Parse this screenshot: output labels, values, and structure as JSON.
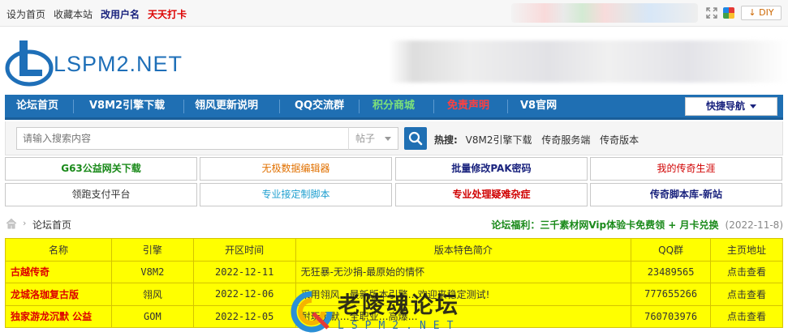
{
  "topbar": {
    "links": [
      "设为首页",
      "收藏本站"
    ],
    "rename_label": "改用户名",
    "checkin_label": "天天打卡",
    "diy_label": "DIY"
  },
  "header": {
    "logo_text": "LSPM2.NET",
    "brand_color": "#1e6fb8"
  },
  "nav": {
    "items": [
      {
        "label": "论坛首页"
      },
      {
        "label": "V8M2引擎下载"
      },
      {
        "label": "翎风更新说明"
      },
      {
        "label": "QQ交流群"
      },
      {
        "label": "积分商城"
      },
      {
        "label": "免责声明"
      },
      {
        "label": "V8官网"
      }
    ],
    "quick_label": "快捷导航",
    "bg_color": "#1f6fb3"
  },
  "search": {
    "placeholder": "请输入搜索内容",
    "type_value": "帖子",
    "hot_label": "热搜:",
    "hot_links": [
      "V8M2引擎下载",
      "传奇服务端",
      "传奇版本"
    ]
  },
  "quick_links": [
    {
      "label": "G63公益网关下载",
      "color": "#1a8a1a"
    },
    {
      "label": "无极数据编辑器",
      "color": "#e07000"
    },
    {
      "label": "批量修改PAK密码",
      "color": "#1a237e"
    },
    {
      "label": "我的传奇生涯",
      "color": "#d00000"
    },
    {
      "label": "领跑支付平台",
      "color": "#333333"
    },
    {
      "label": "专业接定制脚本",
      "color": "#20a0d0"
    },
    {
      "label": "专业处理疑难杂症",
      "color": "#d00000"
    },
    {
      "label": "传奇脚本库-新站",
      "color": "#1a237e"
    }
  ],
  "breadcrumb": {
    "current": "论坛首页",
    "promo": "论坛福利：三千素材网Vip体验卡免费领 + 月卡兑换",
    "promo_date": "(2022-11-8)"
  },
  "table": {
    "headers": [
      "名称",
      "引擎",
      "开区时间",
      "版本特色简介",
      "QQ群",
      "主页地址"
    ],
    "rows": [
      {
        "name": "古越传奇",
        "engine": "V8M2",
        "date": "2022-12-11",
        "desc": "无狂暴-无沙捐-最原始的情怀",
        "qq": "23489565",
        "link": "点击查看"
      },
      {
        "name": "龙城洛珈复古版",
        "engine": "翎风",
        "date": "2022-12-06",
        "desc": "采用翎风…最新版本引擎…欢迎来稳定测试!",
        "qq": "777655266",
        "link": "点击查看"
      },
      {
        "name": "独家游龙沉默 公益",
        "engine": "GOM",
        "date": "2022-12-05",
        "desc": "耐玩沉默…全职业…高爆…",
        "qq": "760703976",
        "link": "点击查看"
      }
    ]
  },
  "watermark": {
    "title": "老陵魂论坛",
    "subtitle": "LSPM2.NET"
  }
}
